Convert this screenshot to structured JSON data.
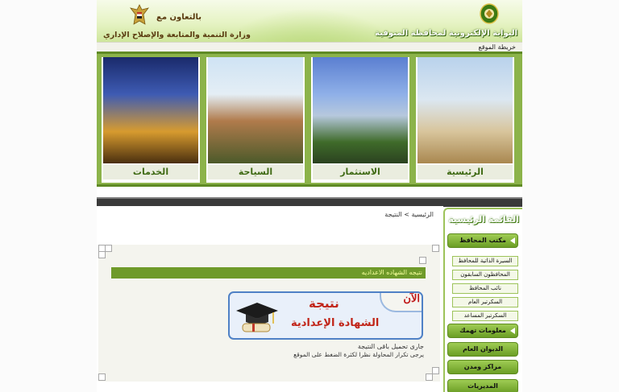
{
  "header": {
    "portal_title": "البوابة الإلكترونية لمحافظة المنوفية",
    "cooperation_label": "بالتعاون مع",
    "ministry_label": "وزارة التنمية والمتابعة والإصلاح الإداري"
  },
  "top_bar": {
    "sitemap_label": "خريطة الموقع"
  },
  "banner": {
    "tiles": [
      {
        "label": "الخدمات"
      },
      {
        "label": "السياحة"
      },
      {
        "label": "الاستثمار"
      },
      {
        "label": "الرئيسية"
      }
    ]
  },
  "content": {
    "breadcrumb": "الرئيسية > النتيجة",
    "result_heading": "نتيجه الشهاده الاعداديه",
    "banner_now": "الآن",
    "banner_result": "نتيجة",
    "banner_certificate": "الشهادة الإعدادية",
    "loading_text": "جارى تحميل باقى النتيجة",
    "retry_text": "يرجى تكرار المحاولة نظرا لكثرة الضغط على الموقع"
  },
  "sidebar": {
    "title": "القائمة الرئيسية",
    "governor_office": "مكتب المحافظ",
    "sub_items": [
      "السيرة الذاتية للمحافظ",
      "المحافظون السابقون",
      "نائب المحافظ",
      "السكرتير العام",
      "السكرتير المساعد"
    ],
    "info_menu": "معلومات تهمك",
    "diwan": "الديوان العام",
    "centers": "مراكز ومدن",
    "directorates": "المديريات"
  },
  "icons": {
    "gov_emblem": "governorate-emblem-icon",
    "eagle_emblem": "egypt-eagle-emblem-icon",
    "grad_cap": "graduation-cap-icon",
    "menu_arrow": "menu-arrow-icon"
  },
  "colors": {
    "accent_green": "#6f9a2a",
    "banner_red": "#c12418",
    "frame_blue": "#4f81c6"
  }
}
